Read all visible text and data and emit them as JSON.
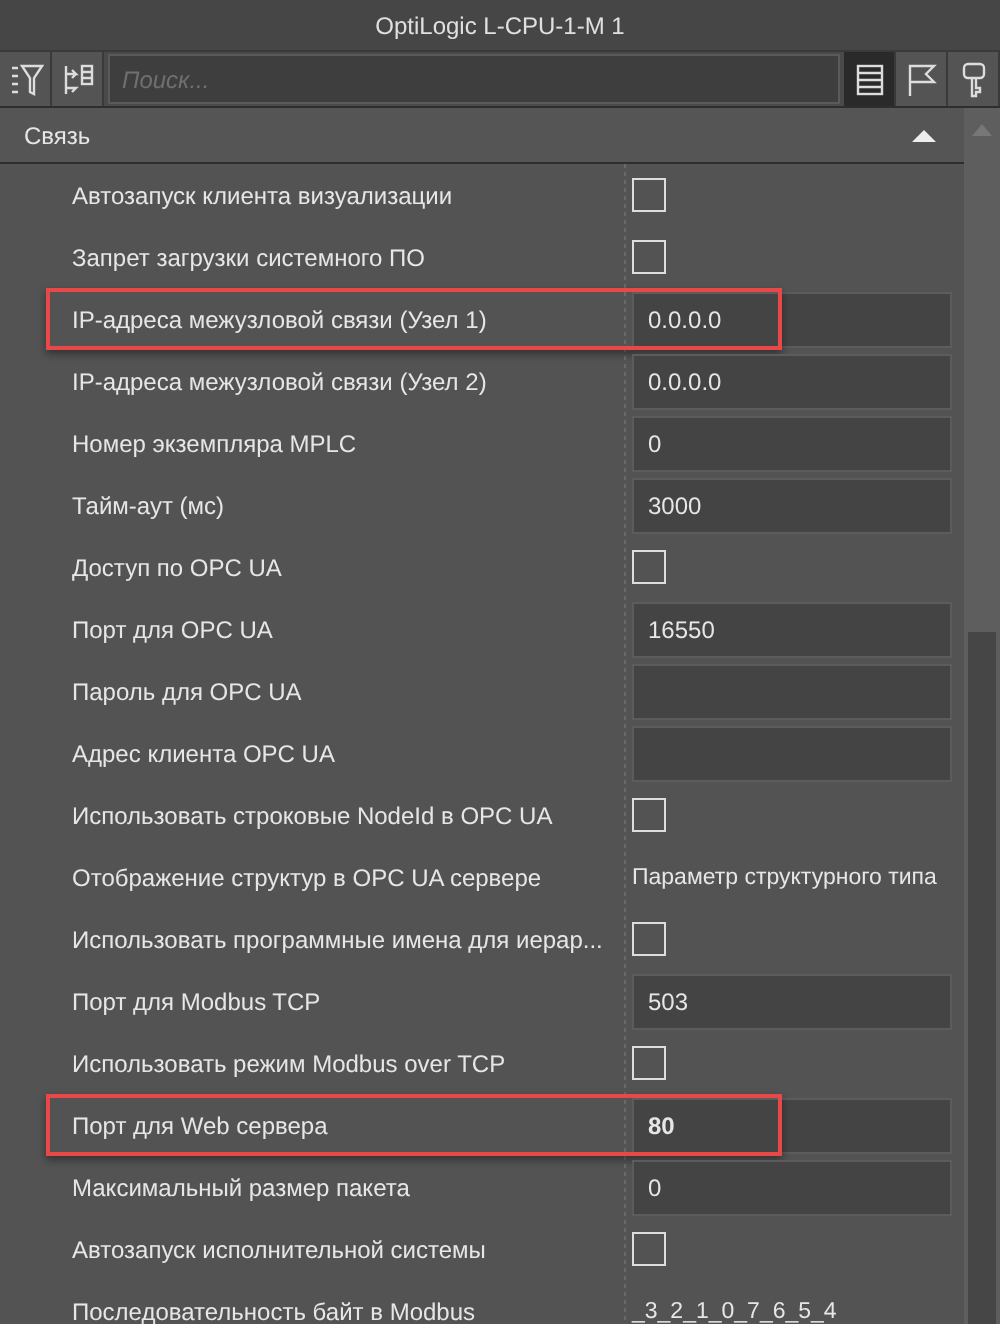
{
  "window": {
    "title": "OptiLogic L-CPU-1-M 1"
  },
  "toolbar": {
    "left_buttons": [
      {
        "kind": "sort"
      },
      {
        "kind": "tree"
      }
    ],
    "search": {
      "placeholder": "Поиск..."
    },
    "right_buttons": [
      {
        "kind": "list",
        "selected": true
      },
      {
        "kind": "flag",
        "selected": false
      },
      {
        "kind": "key",
        "selected": false
      }
    ]
  },
  "section": {
    "title": "Связь",
    "expanded": true
  },
  "rows": [
    {
      "label": "Автозапуск клиента визуализации",
      "kind": "checkbox",
      "checked": false,
      "highlighted": false
    },
    {
      "label": "Запрет загрузки системного ПО",
      "kind": "checkbox",
      "checked": false,
      "highlighted": false
    },
    {
      "label": "IP-адреса межузловой связи (Узел 1)",
      "kind": "field",
      "value": "0.0.0.0",
      "modified": false,
      "highlighted": true
    },
    {
      "label": "IP-адреса межузловой связи (Узел 2)",
      "kind": "field",
      "value": "0.0.0.0",
      "modified": false,
      "highlighted": false
    },
    {
      "label": "Номер экземпляра MPLC",
      "kind": "field",
      "value": "0",
      "modified": false,
      "highlighted": false
    },
    {
      "label": "Тайм-аут (мс)",
      "kind": "field",
      "value": "3000",
      "modified": false,
      "highlighted": false
    },
    {
      "label": "Доступ по OPC UA",
      "kind": "checkbox",
      "checked": false,
      "highlighted": false
    },
    {
      "label": "Порт для OPC UA",
      "kind": "field",
      "value": "16550",
      "modified": false,
      "highlighted": false
    },
    {
      "label": "Пароль для OPC UA",
      "kind": "field",
      "modified": false,
      "highlighted": false
    },
    {
      "label": "Адрес клиента OPC UA",
      "kind": "field",
      "modified": false,
      "highlighted": false
    },
    {
      "label": "Использовать строковые NodeId в OPC UA",
      "kind": "checkbox",
      "checked": false,
      "highlighted": false
    },
    {
      "label": "Отображение структур в OPC UA сервере",
      "kind": "text",
      "value": "Параметр структурного типа",
      "highlighted": false
    },
    {
      "label": "Использовать программные имена для иерар...",
      "kind": "checkbox",
      "checked": false,
      "highlighted": false
    },
    {
      "label": "Порт для Modbus TCP",
      "kind": "field",
      "value": "503",
      "modified": false,
      "highlighted": false
    },
    {
      "label": "Использовать режим Modbus over TCP",
      "kind": "checkbox",
      "checked": false,
      "highlighted": false
    },
    {
      "label": "Порт для Web сервера",
      "kind": "field",
      "value": "80",
      "modified": true,
      "highlighted": true
    },
    {
      "label": "Максимальный размер пакета",
      "kind": "field",
      "value": "0",
      "modified": false,
      "highlighted": false
    },
    {
      "label": "Автозапуск исполнительной системы",
      "kind": "checkbox",
      "checked": false,
      "highlighted": false
    },
    {
      "label": "Последовательность байт в Modbus",
      "kind": "text",
      "value": "_3_2_1_0_7_6_5_4",
      "highlighted": false
    }
  ]
}
